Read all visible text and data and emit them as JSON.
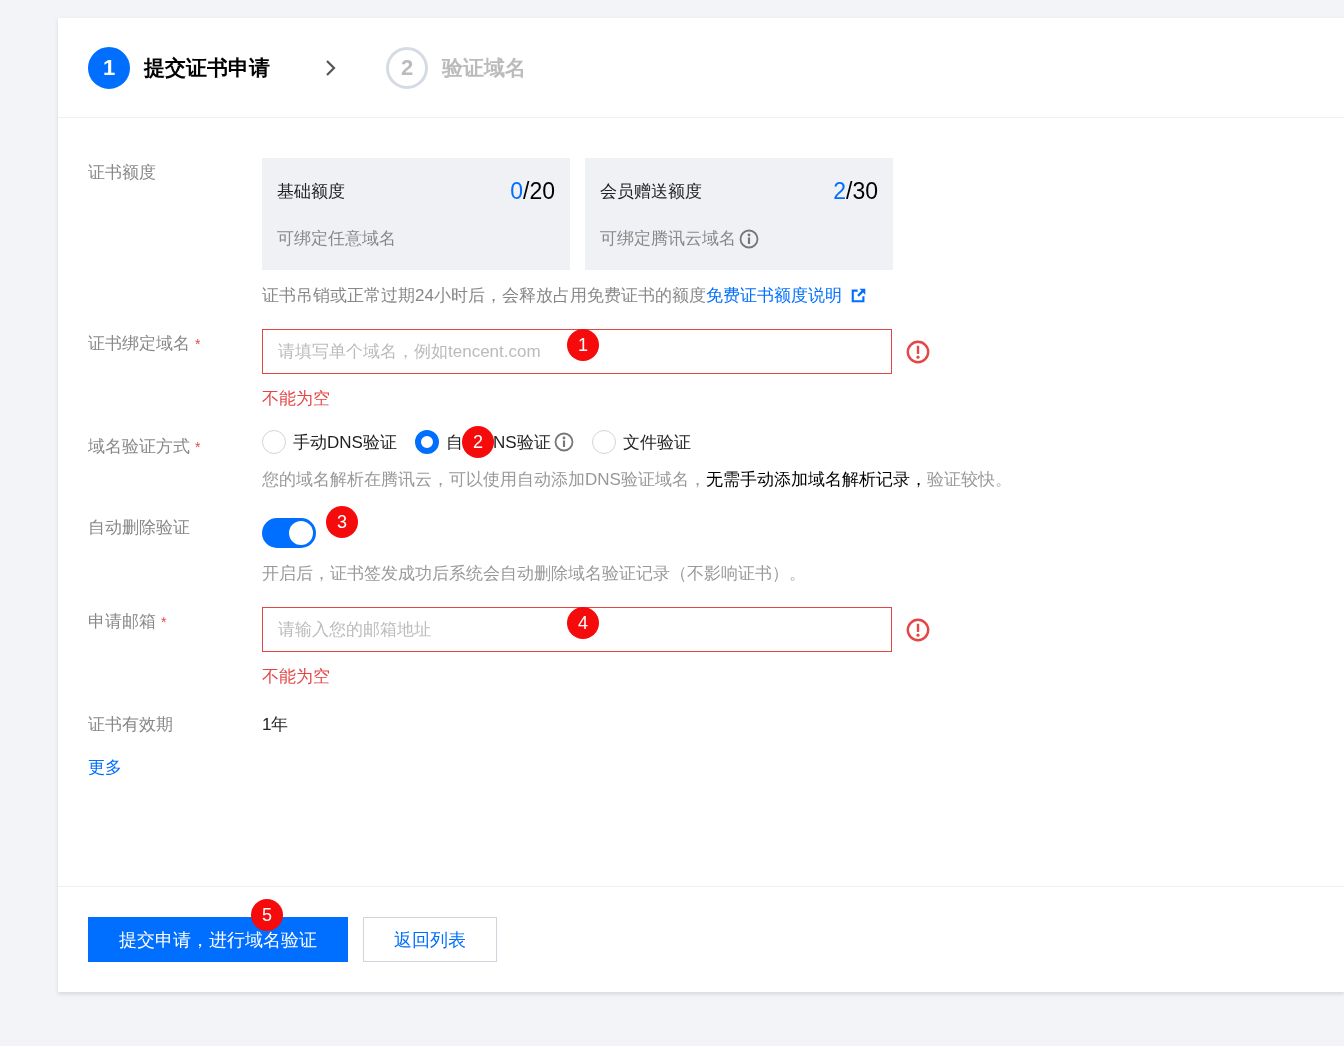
{
  "steps": [
    {
      "number": "1",
      "label": "提交证书申请",
      "selected": true
    },
    {
      "number": "2",
      "label": "验证域名",
      "selected": false
    }
  ],
  "form": {
    "rows": [
      {
        "kind": "quota",
        "label": "证书额度",
        "quotas": [
          {
            "title": "基础额度",
            "used": "0",
            "limit": "/20",
            "desc": "可绑定任意域名",
            "info": false
          },
          {
            "title": "会员赠送额度",
            "used": "2",
            "limit": "/30",
            "desc": "可绑定腾讯云域名",
            "info": true
          }
        ],
        "note": "证书吊销或正常过期24小时后，会释放占用免费证书的额度",
        "link": "免费证书额度说明"
      },
      {
        "kind": "input",
        "label": "证书绑定域名",
        "required_mark": "*",
        "placeholder": "请填写单个域名，例如tencent.com",
        "marker": "1",
        "error": "不能为空"
      },
      {
        "kind": "radio",
        "label": "域名验证方式",
        "required_mark": "*",
        "options": [
          {
            "label": "手动DNS验证",
            "selected": false,
            "info": false
          },
          {
            "label": "自",
            "label_after_marker": "NS验证",
            "selected": true,
            "info": true,
            "marker": "2"
          },
          {
            "label": "文件验证",
            "selected": false,
            "info": false
          }
        ],
        "hint_parts": [
          {
            "text": "您的域名解析在腾讯云，可以使用自动添加DNS验证域名，",
            "emphasis": false
          },
          {
            "text": "无需手动添加域名解析记录，",
            "emphasis": true
          },
          {
            "text": "验证较快。",
            "emphasis": false
          }
        ]
      },
      {
        "kind": "switch",
        "label": "自动删除验证",
        "on": true,
        "marker": "3",
        "hint": "开启后，证书签发成功后系统会自动删除域名验证记录（不影响证书）。"
      },
      {
        "kind": "input",
        "label": "申请邮箱",
        "required_mark": "*",
        "placeholder": "请输入您的邮箱地址",
        "marker": "4",
        "error": "不能为空"
      },
      {
        "kind": "static",
        "label": "证书有效期",
        "value": "1年"
      }
    ],
    "more_link": "更多"
  },
  "footer": {
    "primary": {
      "label": "提交申请，进行域名验证",
      "marker": "5"
    },
    "secondary": {
      "label": "返回列表"
    }
  }
}
